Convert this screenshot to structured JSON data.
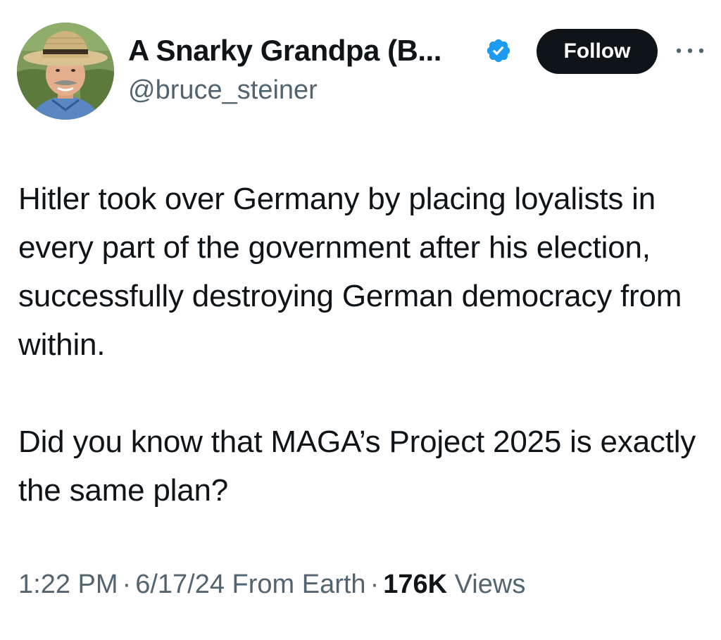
{
  "author": {
    "display_name": "A Snarky Grandpa (B...",
    "handle": "@bruce_steiner",
    "avatar_icon": "profile-photo-man-straw-hat",
    "verified_icon": "verified-badge-icon",
    "verified_color": "#1d9bf0"
  },
  "actions": {
    "follow_label": "Follow",
    "more_icon": "more-horizontal-icon"
  },
  "tweet": {
    "paragraphs": [
      "Hitler took over Germany by placing loyalists in every part of the government after his election, successfully destroying German democracy from within.",
      "Did you know that MAGA’s Project 2025 is exactly the same plan?"
    ]
  },
  "meta": {
    "time": "1:22 PM",
    "separator": "·",
    "date_source": "6/17/24 From Earth",
    "views_count": "176K",
    "views_label": "Views"
  },
  "colors": {
    "text_primary": "#0f1419",
    "text_secondary": "#536471",
    "button_bg": "#0f1419",
    "button_text": "#ffffff"
  }
}
